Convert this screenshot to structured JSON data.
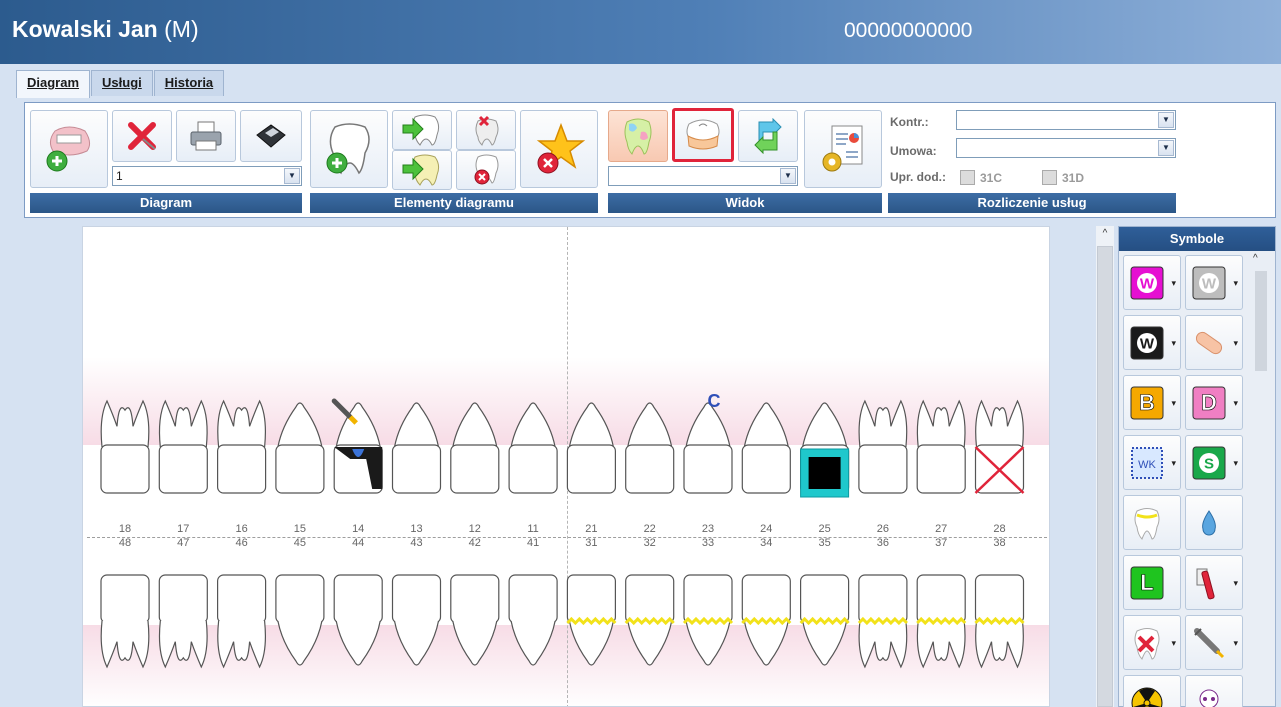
{
  "window": {
    "patient_name": "Kowalski Jan",
    "sex": "(M)",
    "pesel": "00000000000"
  },
  "tabs": [
    {
      "label": "Diagram"
    },
    {
      "label": "Usługi"
    },
    {
      "label": "Historia"
    }
  ],
  "ribbon": {
    "diagram_combo": "1",
    "view_combo": "",
    "groups": {
      "diagram": "Diagram",
      "elements": "Elementy diagramu",
      "view": "Widok",
      "billing": "Rozliczenie usług"
    },
    "kontr_label": "Kontr.:",
    "kontr_value": "",
    "umowa_label": "Umowa:",
    "umowa_value": "",
    "upr_label": "Upr. dod.:",
    "chk_31c": "31C",
    "chk_31d": "31D"
  },
  "diagram": {
    "upper_numbers": [
      "18",
      "17",
      "16",
      "15",
      "14",
      "13",
      "12",
      "11",
      "21",
      "22",
      "23",
      "24",
      "25",
      "26",
      "27",
      "28"
    ],
    "lower_numbers": [
      "48",
      "47",
      "46",
      "45",
      "44",
      "43",
      "42",
      "41",
      "31",
      "32",
      "33",
      "34",
      "35",
      "36",
      "37",
      "38"
    ],
    "annotation_c": "C"
  },
  "symbols": {
    "title": "Symbole",
    "items": [
      {
        "name": "W (magenta)",
        "icon": "w-magenta-icon",
        "letter": "W",
        "color": "#e60fd2",
        "dropdown": true
      },
      {
        "name": "W (gray)",
        "icon": "w-gray-icon",
        "letter": "W",
        "color": "#bdbdbd",
        "dropdown": true
      },
      {
        "name": "W (black)",
        "icon": "w-black-icon",
        "letter": "W",
        "color": "#1a1a1a",
        "dropdown": true
      },
      {
        "name": "bandage",
        "icon": "bandage-icon",
        "dropdown": true
      },
      {
        "name": "B",
        "icon": "b-orange-icon",
        "letter": "B",
        "color": "#f5a800",
        "dropdown": true
      },
      {
        "name": "D",
        "icon": "d-pink-icon",
        "letter": "D",
        "color": "#f07fc3",
        "dropdown": true
      },
      {
        "name": "WK",
        "icon": "wk-pattern-icon",
        "dropdown": true
      },
      {
        "name": "S",
        "icon": "s-green-icon",
        "letter": "S",
        "color": "#19a84a",
        "dropdown": true
      },
      {
        "name": "tooth",
        "icon": "tooth-yellow-icon",
        "dropdown": false
      },
      {
        "name": "drop",
        "icon": "drop-icon",
        "dropdown": false
      },
      {
        "name": "L",
        "icon": "l-green-icon",
        "letter": "L",
        "color": "#1fc41f",
        "dropdown": false
      },
      {
        "name": "toothbrush",
        "icon": "toothbrush-icon",
        "dropdown": true
      },
      {
        "name": "extraction",
        "icon": "tooth-x-icon",
        "dropdown": true
      },
      {
        "name": "syringe",
        "icon": "syringe-icon",
        "dropdown": true
      },
      {
        "name": "radiation",
        "icon": "radiation-icon",
        "dropdown": false
      },
      {
        "name": "skull",
        "icon": "skull-icon",
        "dropdown": false
      }
    ]
  }
}
